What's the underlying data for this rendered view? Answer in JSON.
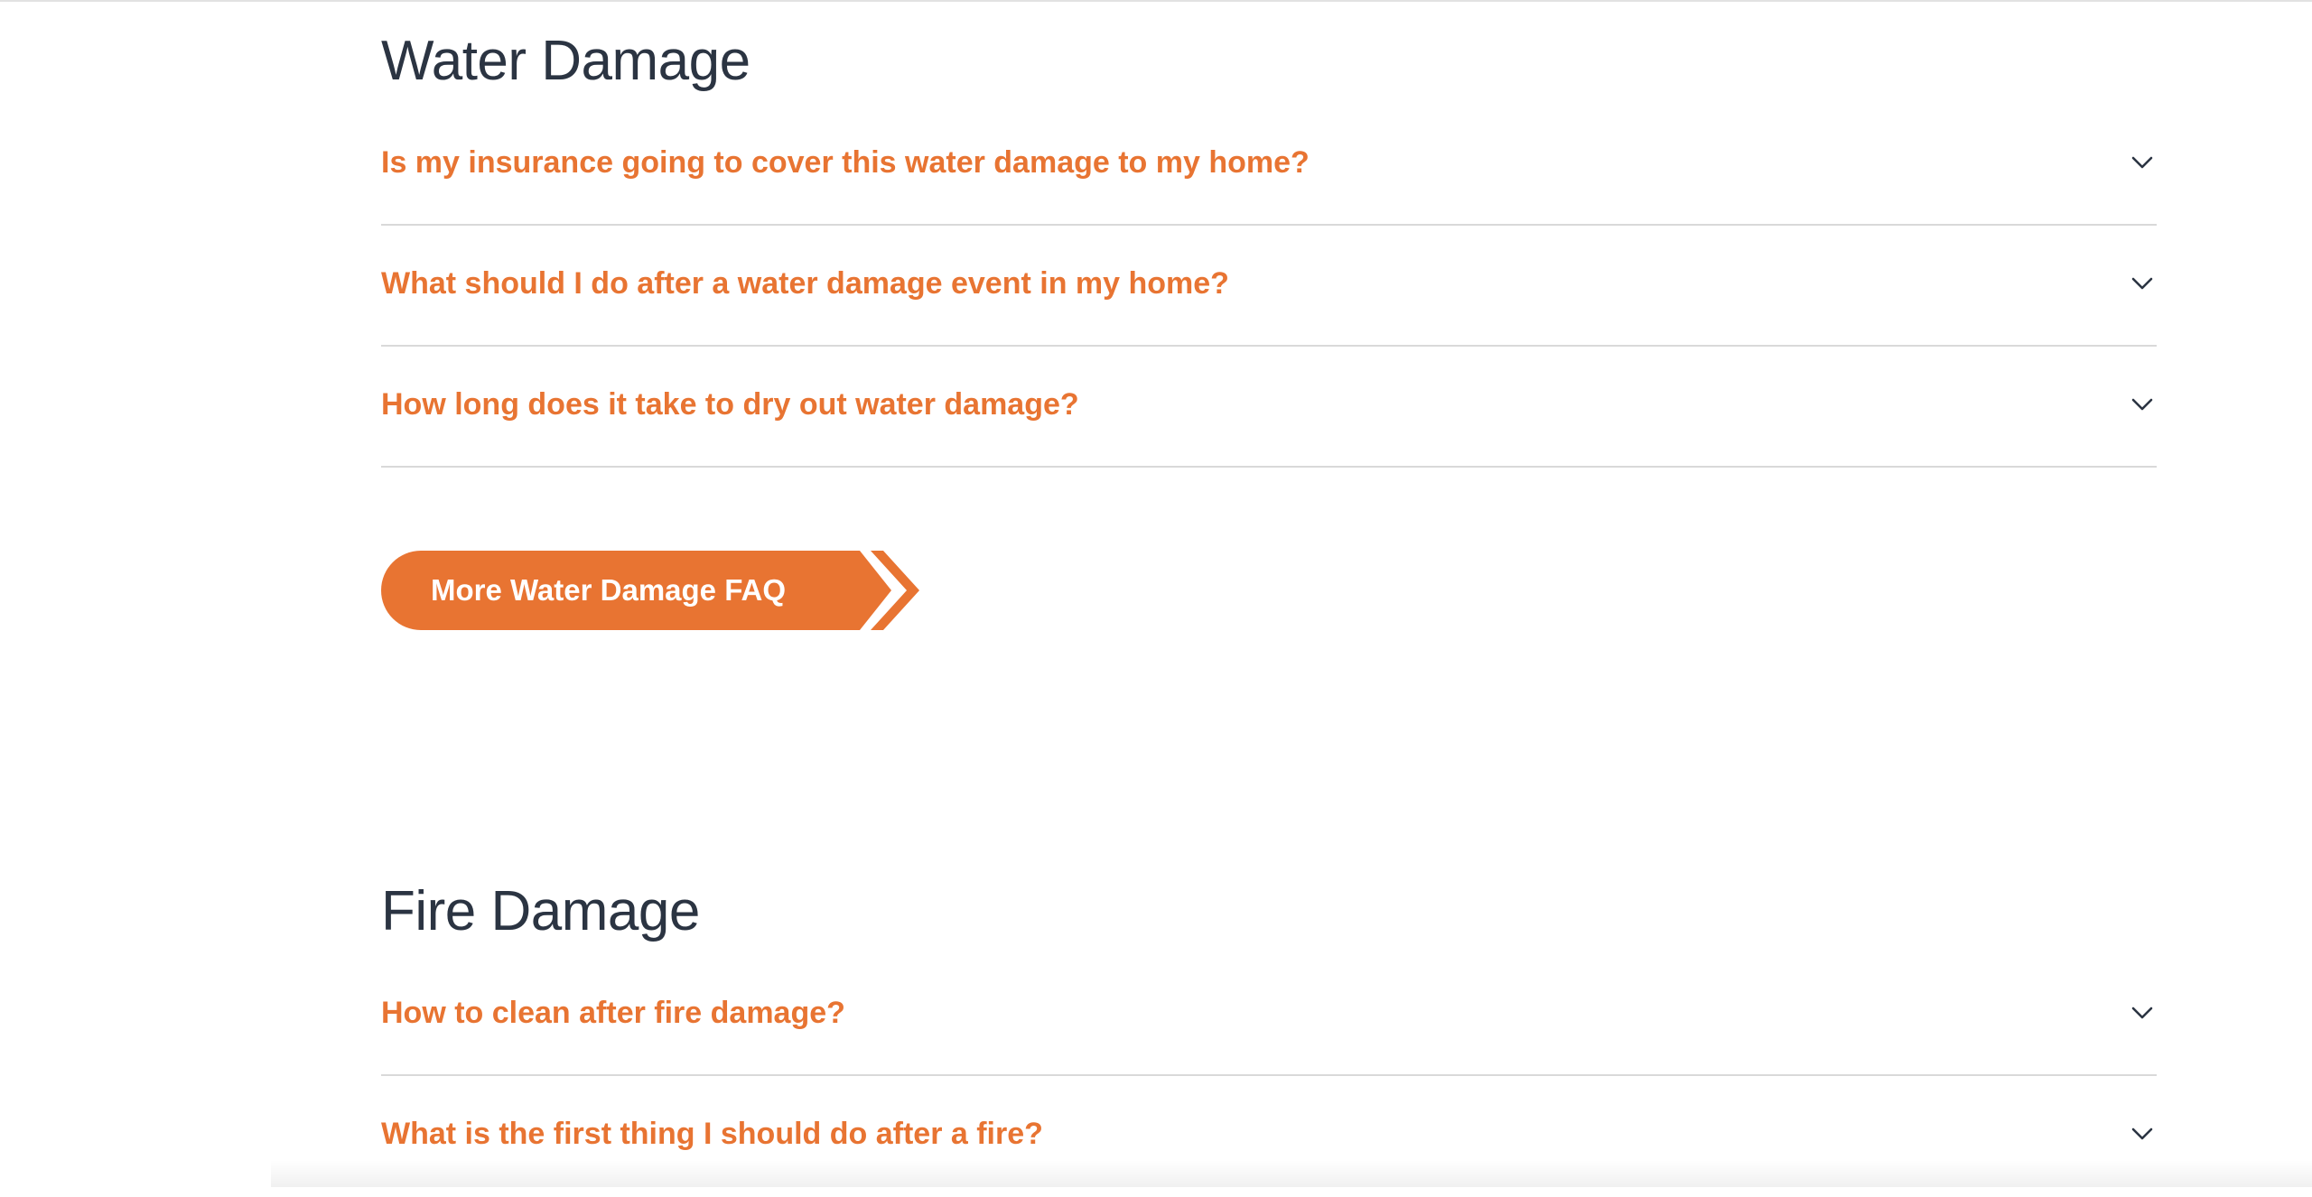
{
  "water_section": {
    "title": "Water Damage",
    "faqs": [
      {
        "question": "Is my insurance going to cover this water damage to my home?"
      },
      {
        "question": "What should I do after a water damage event in my home?"
      },
      {
        "question": "How long does it take to dry out water damage?"
      }
    ],
    "cta_label": "More Water Damage FAQ"
  },
  "fire_section": {
    "title": "Fire Damage",
    "faqs": [
      {
        "question": "How to clean after fire damage?"
      },
      {
        "question": "What is the first thing I should do after a fire?"
      }
    ]
  },
  "icons": {
    "expand": "chevron-down-icon",
    "cta_arrow": "double-chevron-right-icon"
  },
  "colors": {
    "accent": "#e87432",
    "heading": "#2b3442",
    "divider": "#d9d9d9",
    "background": "#ffffff"
  }
}
